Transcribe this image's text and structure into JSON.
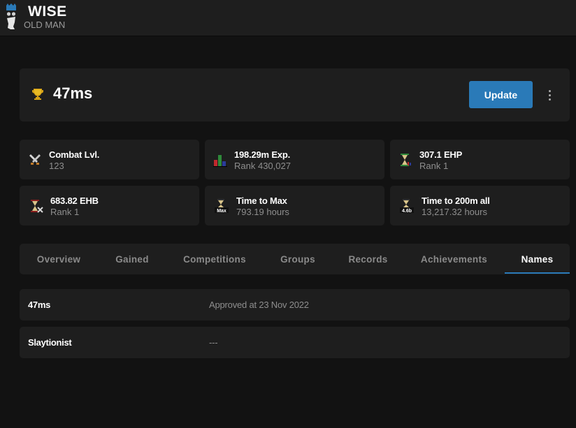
{
  "app": {
    "logo_title": "WISE",
    "logo_subtitle": "OLD MAN"
  },
  "player": {
    "name": "47ms",
    "update_label": "Update"
  },
  "stats": [
    {
      "icon": "crossed-swords-icon",
      "title": "Combat Lvl.",
      "sub": "123"
    },
    {
      "icon": "stats-bars-icon",
      "title": "198.29m Exp.",
      "sub": "Rank 430,027"
    },
    {
      "icon": "ehp-hourglass-icon",
      "title": "307.1 EHP",
      "sub": "Rank 1"
    },
    {
      "icon": "ehb-hourglass-icon",
      "title": "683.82 EHB",
      "sub": "Rank 1"
    },
    {
      "icon": "max-hourglass-icon",
      "title": "Time to Max",
      "sub": "793.19 hours"
    },
    {
      "icon": "200m-hourglass-icon",
      "title": "Time to 200m all",
      "sub": "13,217.32 hours"
    }
  ],
  "tabs": [
    {
      "label": "Overview",
      "active": false
    },
    {
      "label": "Gained",
      "active": false
    },
    {
      "label": "Competitions",
      "active": false
    },
    {
      "label": "Groups",
      "active": false
    },
    {
      "label": "Records",
      "active": false
    },
    {
      "label": "Achievements",
      "active": false
    },
    {
      "label": "Names",
      "active": true
    }
  ],
  "names": [
    {
      "name": "47ms",
      "status": "Approved at 23 Nov 2022"
    },
    {
      "name": "Slaytionist",
      "status": "---"
    }
  ],
  "colors": {
    "accent": "#2a7ab8",
    "background": "#121212",
    "card": "#1e1e1e"
  }
}
